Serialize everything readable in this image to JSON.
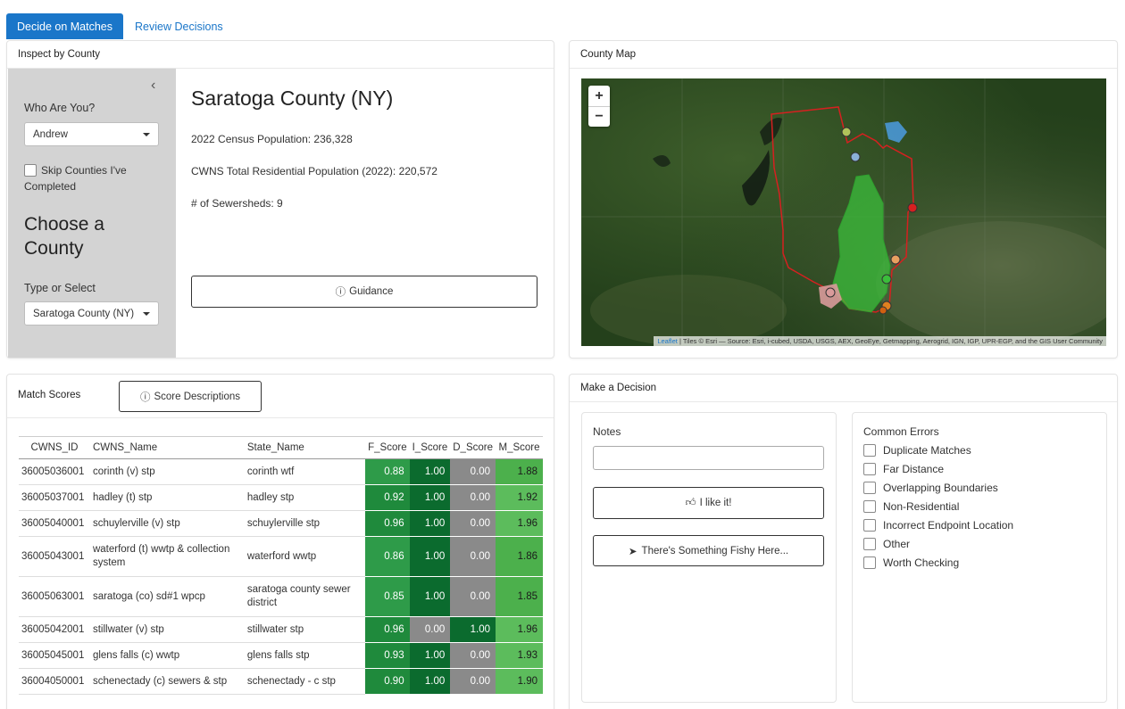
{
  "tabs": [
    {
      "label": "Decide on Matches",
      "active": true
    },
    {
      "label": "Review Decisions",
      "active": false
    }
  ],
  "inspect": {
    "title": "Inspect by County",
    "who_label": "Who Are You?",
    "who_value": "Andrew",
    "skip_label": "Skip Counties I've Completed",
    "choose_title": "Choose a County",
    "type_label": "Type or Select",
    "county_value": "Saratoga County (NY)",
    "county_title": "Saratoga County (NY)",
    "census_pop": "2022 Census Population: 236,328",
    "cwns_pop": "CWNS Total Residential Population (2022): 220,572",
    "sewersheds": "# of Sewersheds: 9",
    "guidance_label": "Guidance"
  },
  "map": {
    "title": "County Map",
    "zoom_in": "+",
    "zoom_out": "−",
    "attribution_link": "Leaflet",
    "attribution_text": " | Tiles © Esri — Source: Esri, i-cubed, USDA, USGS, AEX, GeoEye, Getmapping, Aerogrid, IGN, IGP, UPR-EGP, and the GIS User Community"
  },
  "scores": {
    "title": "Match Scores",
    "desc_button": "Score Descriptions",
    "columns": [
      "CWNS_ID",
      "CWNS_Name",
      "State_Name",
      "F_Score",
      "I_Score",
      "D_Score",
      "M_Score"
    ],
    "rows": [
      {
        "id": "36005036001",
        "cwns": "corinth (v) stp",
        "state": "corinth wtf",
        "f": "0.88",
        "i": "1.00",
        "d": "0.00",
        "m": "1.88"
      },
      {
        "id": "36005037001",
        "cwns": "hadley (t) stp",
        "state": "hadley stp",
        "f": "0.92",
        "i": "1.00",
        "d": "0.00",
        "m": "1.92"
      },
      {
        "id": "36005040001",
        "cwns": "schuylerville (v) stp",
        "state": "schuylerville stp",
        "f": "0.96",
        "i": "1.00",
        "d": "0.00",
        "m": "1.96"
      },
      {
        "id": "36005043001",
        "cwns": "waterford (t) wwtp & collection system",
        "state": "waterford wwtp",
        "f": "0.86",
        "i": "1.00",
        "d": "0.00",
        "m": "1.86"
      },
      {
        "id": "36005063001",
        "cwns": "saratoga (co) sd#1 wpcp",
        "state": "saratoga county sewer district",
        "f": "0.85",
        "i": "1.00",
        "d": "0.00",
        "m": "1.85"
      },
      {
        "id": "36005042001",
        "cwns": "stillwater (v) stp",
        "state": "stillwater stp",
        "f": "0.96",
        "i": "0.00",
        "d": "1.00",
        "m": "1.96"
      },
      {
        "id": "36005045001",
        "cwns": "glens falls (c) wwtp",
        "state": "glens falls stp",
        "f": "0.93",
        "i": "1.00",
        "d": "0.00",
        "m": "1.93"
      },
      {
        "id": "36004050001",
        "cwns": "schenectady (c) sewers & stp",
        "state": "schenectady - c stp",
        "f": "0.90",
        "i": "1.00",
        "d": "0.00",
        "m": "1.90"
      }
    ]
  },
  "decision": {
    "title": "Make a Decision",
    "notes_label": "Notes",
    "notes_value": "",
    "like_label": "I like it!",
    "fishy_label": "There's Something Fishy Here...",
    "errors_title": "Common Errors",
    "errors": [
      "Duplicate Matches",
      "Far Distance",
      "Overlapping Boundaries",
      "Non-Residential",
      "Incorrect Endpoint Location",
      "Other",
      "Worth Checking"
    ]
  },
  "colors": {
    "tab_active": "#1a76c9",
    "score_dark": "#0b6b2e",
    "score_mid": "#2e9b49",
    "score_light": "#5cbc5c",
    "score_zero": "#8a8a8a"
  }
}
